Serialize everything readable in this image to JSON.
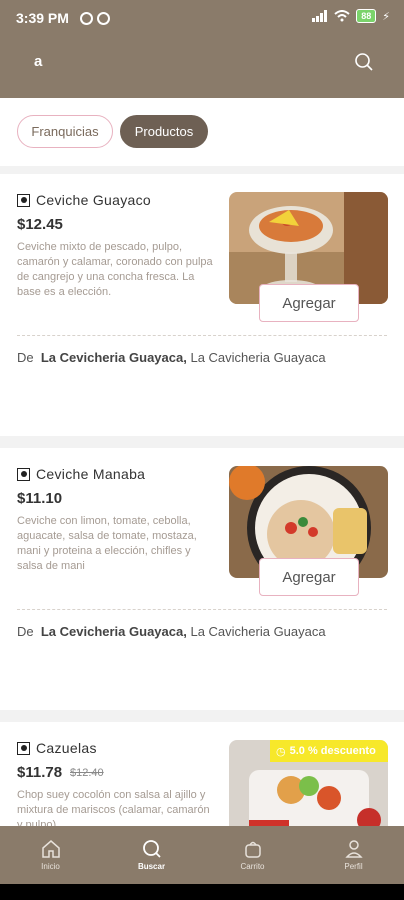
{
  "status": {
    "time": "3:39 PM",
    "battery": "88"
  },
  "header": {
    "query": "a",
    "search_icon": "search-icon"
  },
  "filters": {
    "franquicias": "Franquicias",
    "productos": "Productos"
  },
  "products": [
    {
      "name": "Ceviche Guayaco",
      "price": "$12.45",
      "description": "Ceviche mixto de pescado, pulpo, camarón y calamar, coronado con pulpa de cangrejo y una concha fresca. La base es a elección.",
      "add_label": "Agregar",
      "from_prefix": "De",
      "brand": "La Cevicheria Guayaca,",
      "store": "La Cavicheria Guayaca"
    },
    {
      "name": "Ceviche Manaba",
      "price": "$11.10",
      "description": "Ceviche con limon, tomate, cebolla, aguacate, salsa de tomate, mostaza, mani y proteina a elección, chifles y salsa de mani",
      "add_label": "Agregar",
      "from_prefix": "De",
      "brand": "La Cevicheria Guayaca,",
      "store": "La Cavicheria Guayaca"
    },
    {
      "name": "Cazuelas",
      "price": "$11.78",
      "old_price": "$12.40",
      "discount": "5.0 % descuento",
      "description": "Chop suey cocolón con salsa al ajillo y mixtura de mariscos (calamar, camarón y pulpo)"
    }
  ],
  "tabbar": [
    {
      "label": "Inicio",
      "icon": "home-icon"
    },
    {
      "label": "Buscar",
      "icon": "search-icon"
    },
    {
      "label": "Carrito",
      "icon": "bag-icon"
    },
    {
      "label": "Perfil",
      "icon": "user-icon"
    }
  ],
  "colors": {
    "brand": "#8a7b6a",
    "chip_active": "#6e6054",
    "accent_pink": "#e8b2c0",
    "discount": "#f7e82a"
  }
}
